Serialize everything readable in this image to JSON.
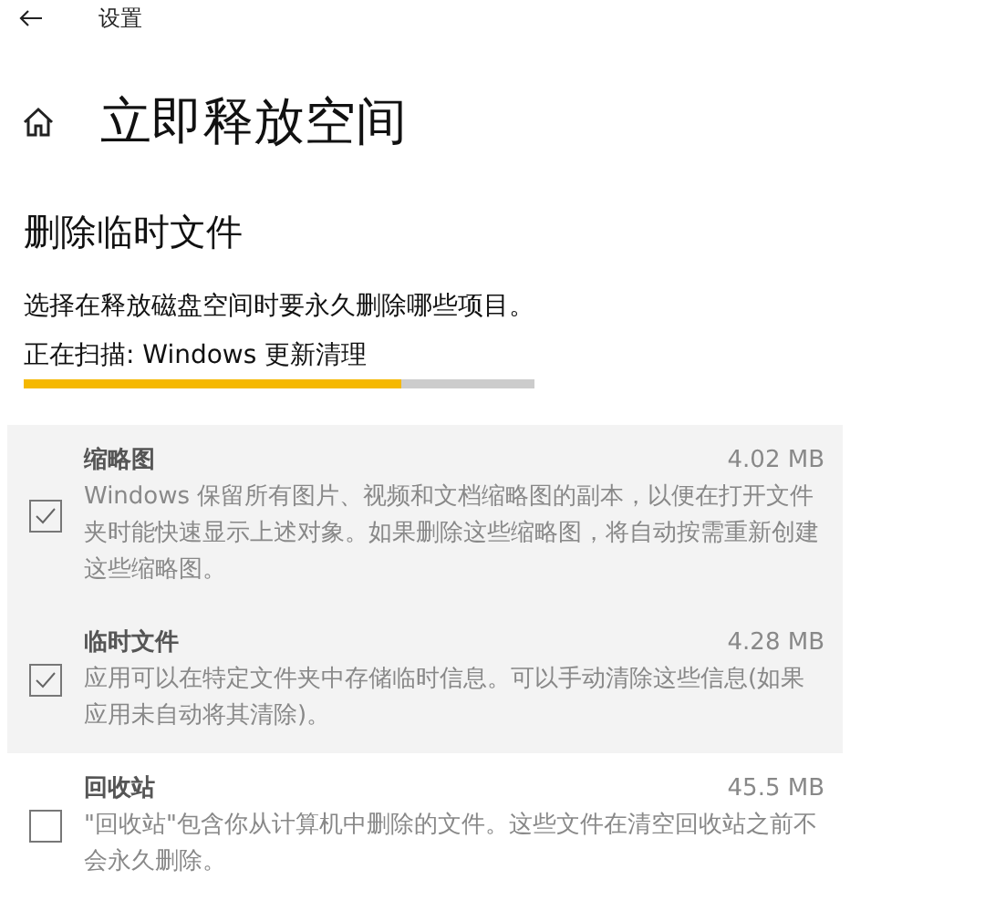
{
  "window": {
    "title": "设置"
  },
  "page": {
    "title": "立即释放空间"
  },
  "section": {
    "title": "删除临时文件",
    "description": "选择在释放磁盘空间时要永久删除哪些项目。",
    "status": "正在扫描: Windows 更新清理",
    "progress": {
      "level": 0.74
    }
  },
  "items": [
    {
      "name": "缩略图",
      "size": "4.02 MB",
      "description": "Windows 保留所有图片、视频和文档缩略图的副本，以便在打开文件夹时能快速显示上述对象。如果删除这些缩略图，将自动按需重新创建这些缩略图。",
      "checked": true,
      "disabled": true
    },
    {
      "name": "临时文件",
      "size": "4.28 MB",
      "description": "应用可以在特定文件夹中存储临时信息。可以手动清除这些信息(如果应用未自动将其清除)。",
      "checked": true,
      "disabled": true
    },
    {
      "name": "回收站",
      "size": "45.5 MB",
      "description": "\"回收站\"包含你从计算机中删除的文件。这些文件在清空回收站之前不会永久删除。",
      "checked": false,
      "disabled": true
    }
  ]
}
